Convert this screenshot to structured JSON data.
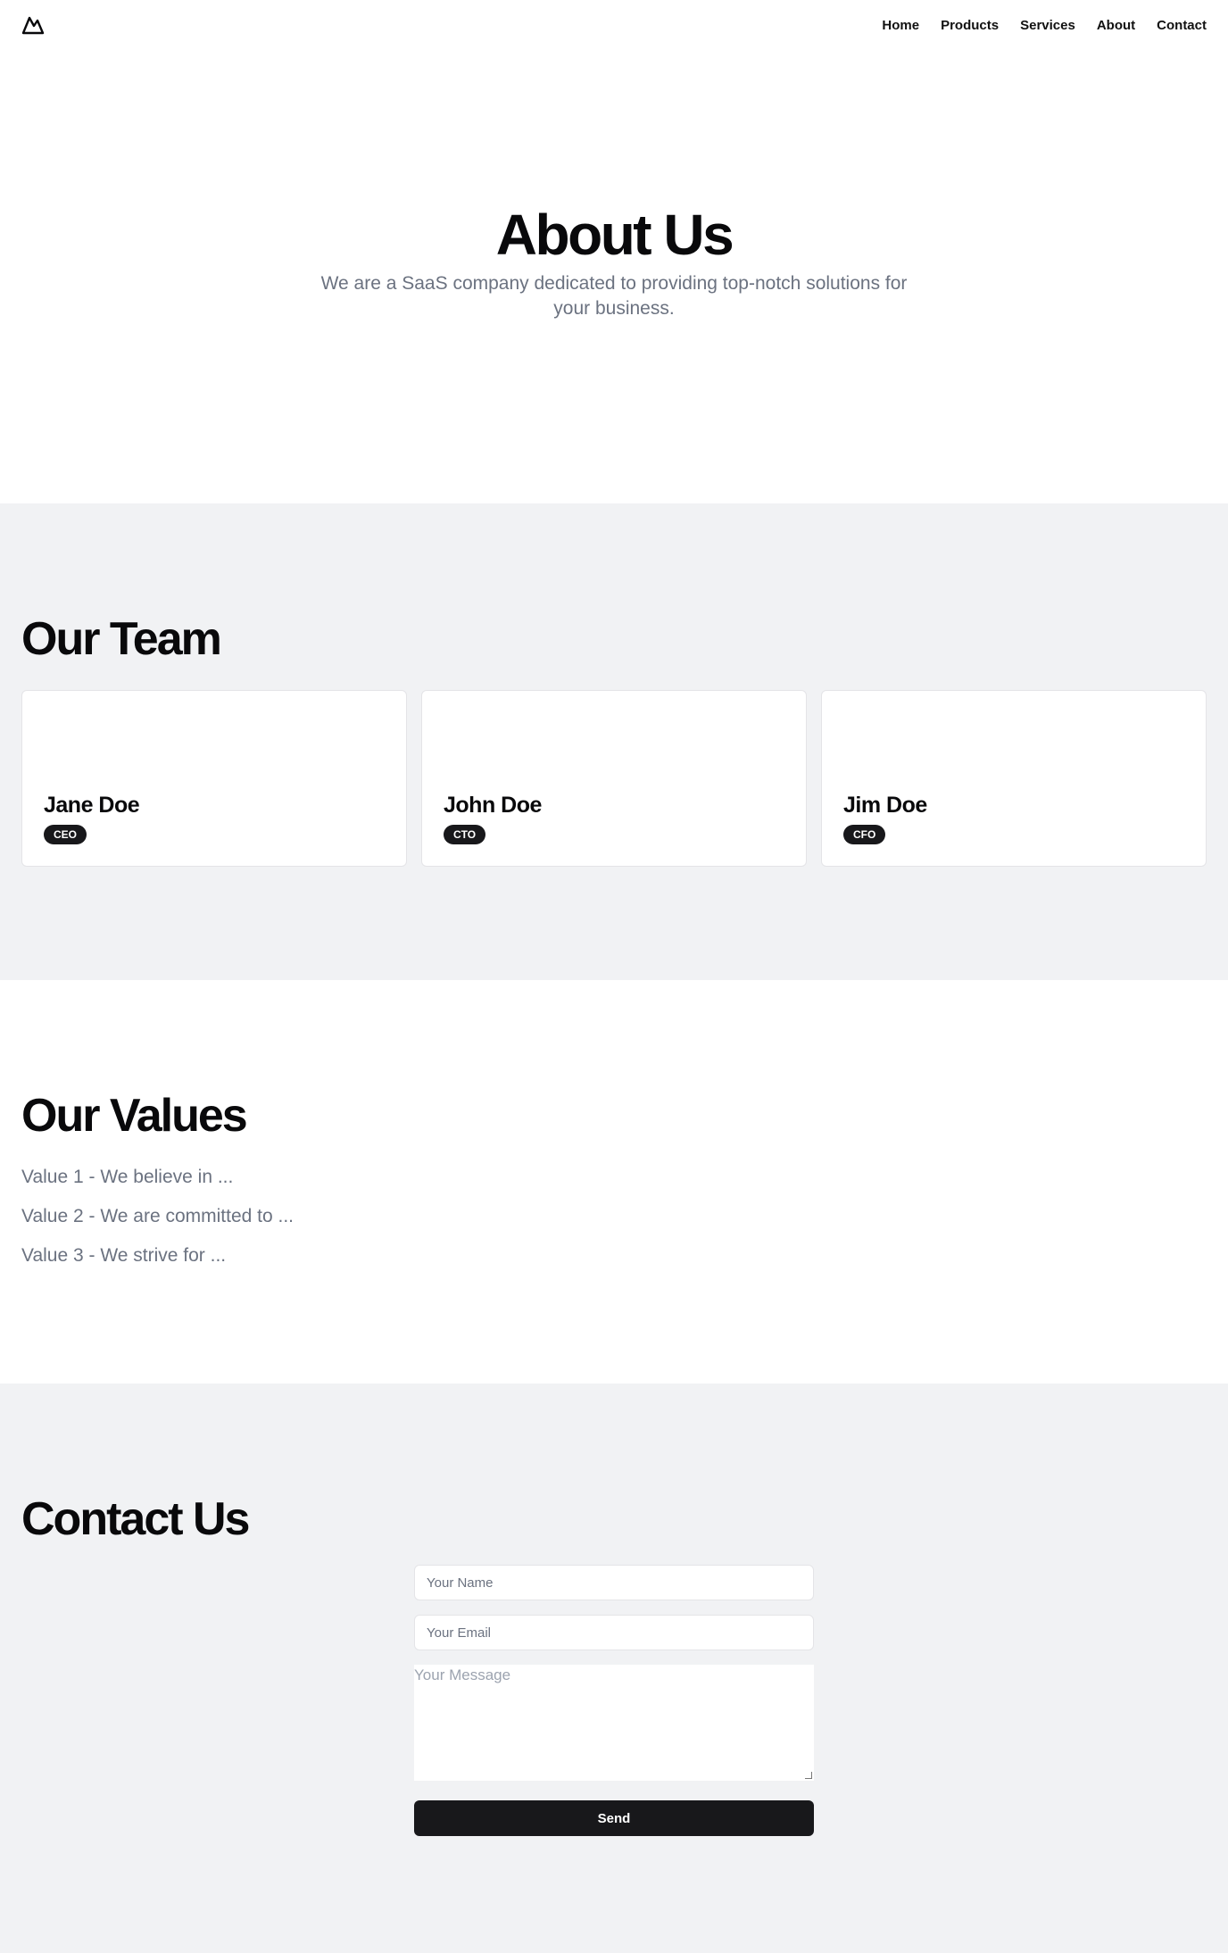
{
  "nav": {
    "logo_icon": "mountain-icon",
    "links": [
      "Home",
      "Products",
      "Services",
      "About",
      "Contact"
    ]
  },
  "hero": {
    "title": "About Us",
    "subtitle": "We are a SaaS company dedicated to providing top-notch solutions for your business."
  },
  "team": {
    "title": "Our Team",
    "members": [
      {
        "name": "Jane Doe",
        "role": "CEO"
      },
      {
        "name": "John Doe",
        "role": "CTO"
      },
      {
        "name": "Jim Doe",
        "role": "CFO"
      }
    ]
  },
  "values": {
    "title": "Our Values",
    "items": [
      "Value 1 - We believe in ...",
      "Value 2 - We are committed to ...",
      "Value 3 - We strive for ..."
    ]
  },
  "contact": {
    "title": "Contact Us",
    "name_placeholder": "Your Name",
    "email_placeholder": "Your Email",
    "message_placeholder": "Your Message",
    "send_label": "Send"
  },
  "colors": {
    "accent": "#18181b",
    "muted_text": "#6b7280",
    "section_bg": "#f1f2f4"
  }
}
